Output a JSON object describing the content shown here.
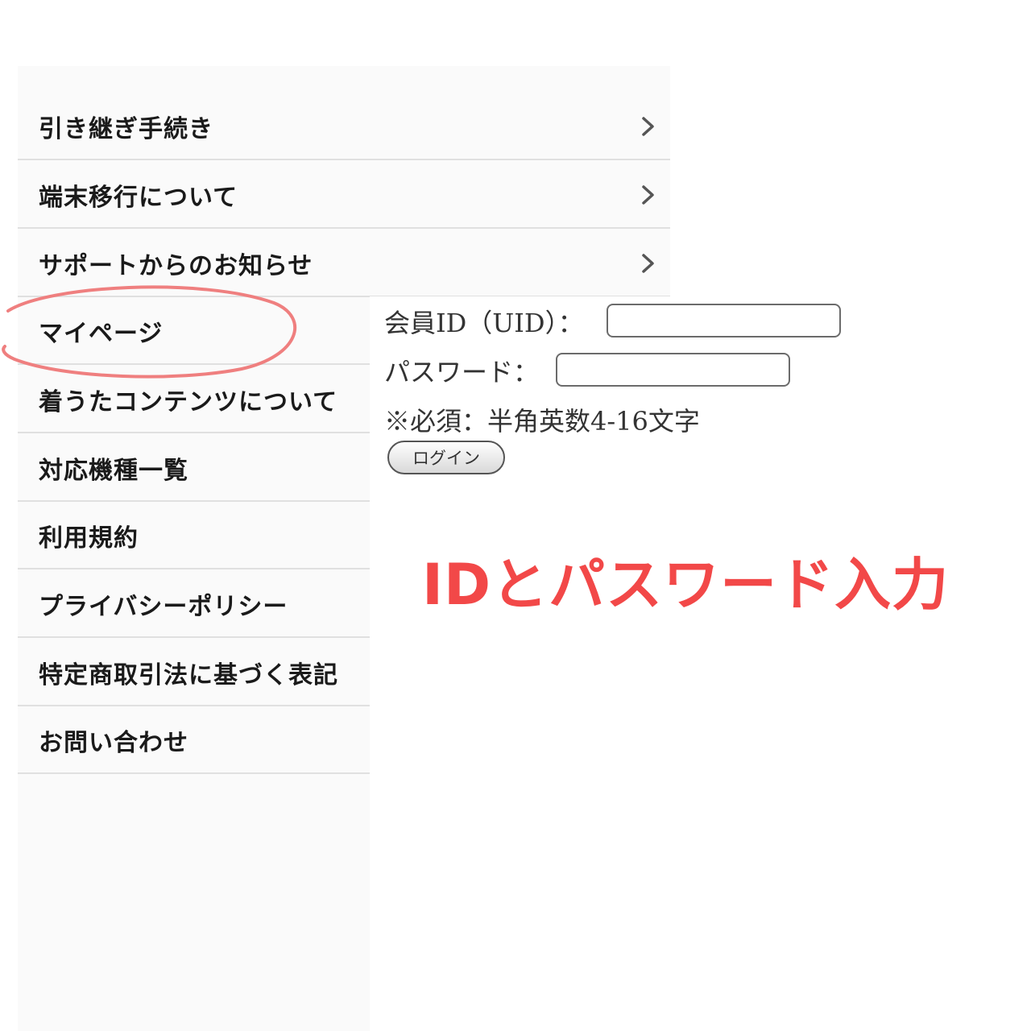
{
  "menu": {
    "items": [
      {
        "label": "引き継ぎ手続き",
        "has_chevron": true
      },
      {
        "label": "端末移行について",
        "has_chevron": true
      },
      {
        "label": "サポートからのお知らせ",
        "has_chevron": true
      },
      {
        "label": "マイページ",
        "has_chevron": false
      },
      {
        "label": "着うたコンテンツについて",
        "has_chevron": false
      },
      {
        "label": "対応機種一覧",
        "has_chevron": false
      },
      {
        "label": "利用規約",
        "has_chevron": false
      },
      {
        "label": "プライバシーポリシー",
        "has_chevron": false
      },
      {
        "label": "特定商取引法に基づく表記",
        "has_chevron": false
      },
      {
        "label": "お問い合わせ",
        "has_chevron": false
      }
    ],
    "chevron_icon": "chevron-right-icon"
  },
  "login": {
    "uid_label": "会員ID（UID）：",
    "uid_value": "",
    "password_label": "パスワード：",
    "password_value": "",
    "note": "※必須：半角英数4-16文字",
    "button_label": "ログイン"
  },
  "annotation": {
    "text": "IDとパスワード入力",
    "color": "#f24848",
    "circle_color": "#ef7f7f",
    "circled_item": "マイページ"
  },
  "colors": {
    "menu_background": "#fafafa",
    "divider": "#e0e0e0",
    "menu_text": "#1a1a1a"
  }
}
